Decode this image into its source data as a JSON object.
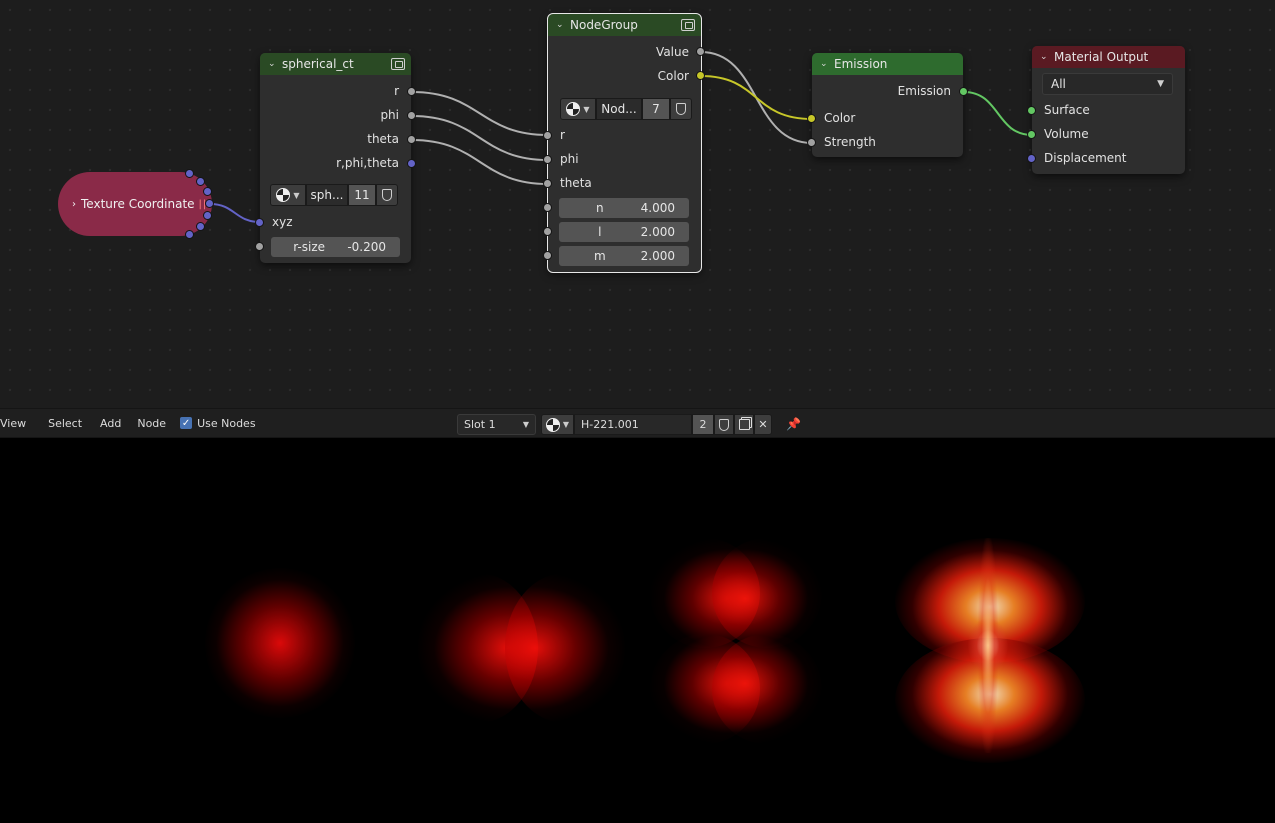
{
  "node_editor": {
    "texture_coordinate": {
      "label": "Texture Coordinate",
      "separator": "||"
    },
    "spherical_ct": {
      "title": "spherical_ct",
      "outputs": [
        "r",
        "phi",
        "theta",
        "r,phi,theta"
      ],
      "datablock": {
        "name": "sph...",
        "users": "11"
      },
      "input_label": "xyz",
      "r_size": {
        "label": "r-size",
        "value": "-0.200"
      }
    },
    "nodegroup": {
      "title": "NodeGroup",
      "outputs": [
        "Value",
        "Color"
      ],
      "datablock": {
        "name": "Nod...",
        "users": "7"
      },
      "inputs": [
        "r",
        "phi",
        "theta"
      ],
      "fields": [
        {
          "label": "n",
          "value": "4.000"
        },
        {
          "label": "l",
          "value": "2.000"
        },
        {
          "label": "m",
          "value": "2.000"
        }
      ]
    },
    "emission": {
      "title": "Emission",
      "output": "Emission",
      "inputs": [
        "Color",
        "Strength"
      ]
    },
    "material_output": {
      "title": "Material Output",
      "target": "All",
      "inputs": [
        "Surface",
        "Volume",
        "Displacement"
      ]
    },
    "colors": {
      "float_socket": "#a1a1a1",
      "color_socket": "#c7c729",
      "shader_socket": "#63c763",
      "vector_socket": "#6363c7"
    }
  },
  "header": {
    "menus": [
      "View",
      "Select",
      "Add",
      "Node"
    ],
    "use_nodes": "Use Nodes",
    "use_nodes_checked": true,
    "slot": "Slot 1",
    "material_name": "H-221.001",
    "material_users": "2"
  }
}
